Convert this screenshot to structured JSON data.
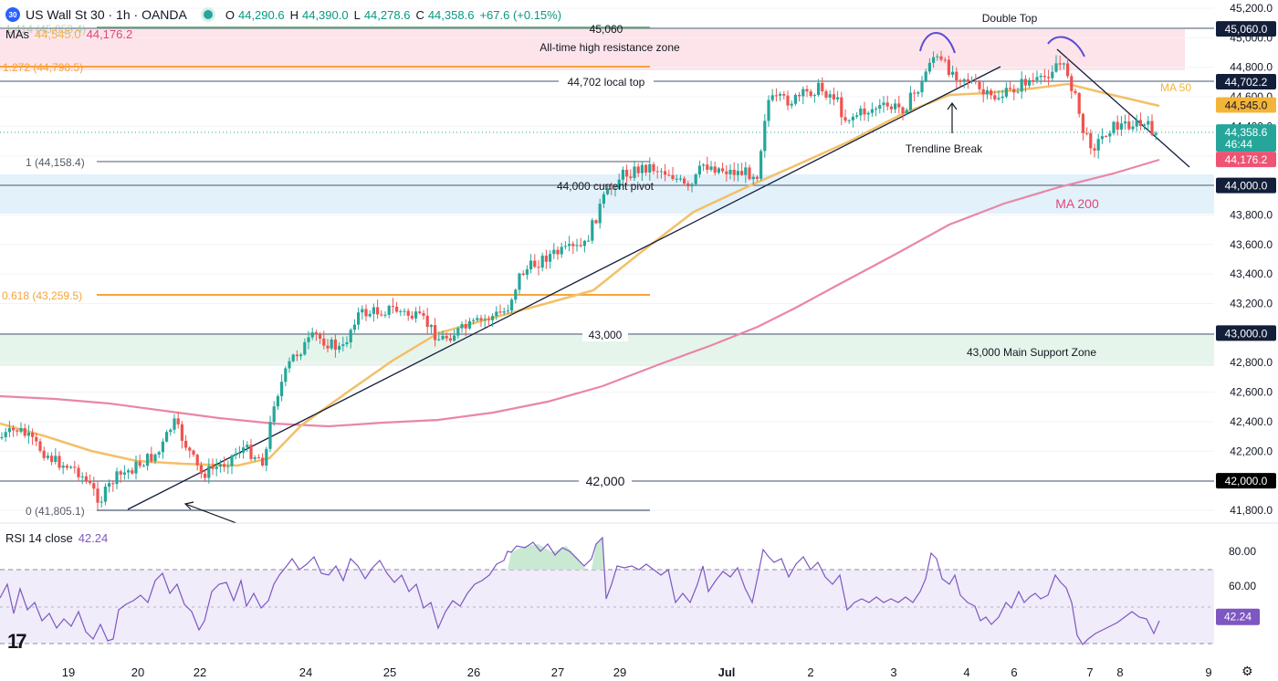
{
  "header": {
    "symbol_badge": "30",
    "title": "US Wall St 30 · 1h · OANDA",
    "ohlc": [
      {
        "k": "O",
        "v": "44,290.6"
      },
      {
        "k": "H",
        "v": "44,390.0"
      },
      {
        "k": "L",
        "v": "44,278.6"
      },
      {
        "k": "C",
        "v": "44,358.6"
      },
      {
        "k": "",
        "v": "+67.6 (+0.15%)"
      }
    ]
  },
  "mas_legend": {
    "label": "MAs",
    "ma50": "44,545.0",
    "ma200": "44,176.2"
  },
  "rsi_legend": {
    "label": "RSI 14 close",
    "value": "42.24"
  },
  "colors": {
    "bull": "#26a69a",
    "bear": "#ef5350",
    "ma50": "#f3c068",
    "ma200": "#e986a8",
    "rsi": "#7e57c2",
    "fib": "#f7a33a",
    "level": "#6b7787",
    "navy": "#131e3a"
  },
  "chart_data": [
    {
      "type": "line",
      "title": "US Wall St 30 · 1h · OANDA",
      "ylim": [
        41700,
        45300
      ],
      "y_ticks": [
        41800,
        42000,
        42200,
        42400,
        42600,
        42800,
        43000,
        43200,
        43400,
        43600,
        43800,
        44000,
        44200,
        44400,
        44600,
        44800,
        45000,
        45200
      ],
      "y_tick_labels": [
        "41,800.0",
        "42,000.0",
        "42,200.0",
        "42,400.0",
        "42,600.0",
        "42,800.0",
        "43,000.0",
        "43,200.0",
        "43,400.0",
        "43,600.0",
        "43,800.0",
        "44,000.0",
        "44,200.0",
        "44,400.0",
        "44,600.0",
        "44,800.0",
        "45,000.0",
        "45,200.0"
      ],
      "x_tick_labels": [
        "19",
        "20",
        "22",
        "24",
        "25",
        "26",
        "27",
        "29",
        "Jul",
        "2",
        "3",
        "4",
        "6",
        "7",
        "8",
        "9"
      ],
      "x_tick_pos": [
        0.5,
        1.5,
        2.5,
        3.5,
        4.5,
        5.5,
        6.5,
        7.5,
        8.5,
        9.5,
        10.5,
        11.5,
        12.5,
        13.5,
        14.5,
        15.5
      ],
      "series": [
        {
          "name": "MA 50",
          "x": [
            0,
            1,
            2,
            3,
            4,
            5,
            6,
            7,
            8,
            9,
            10,
            11,
            12,
            13,
            14
          ],
          "values": [
            42300,
            42190,
            42150,
            42450,
            42950,
            43080,
            43250,
            43800,
            44050,
            44200,
            44400,
            44600,
            44650,
            44700,
            44540
          ]
        },
        {
          "name": "MA 200",
          "x": [
            0,
            1,
            2,
            3,
            4,
            5,
            6,
            7,
            8,
            9,
            10,
            11,
            12,
            13,
            14
          ],
          "values": [
            42590,
            42500,
            42400,
            42400,
            42420,
            42500,
            42580,
            42650,
            42750,
            42900,
            43200,
            43500,
            43750,
            43950,
            44160
          ]
        },
        {
          "name": "Price",
          "x": [
            0,
            1,
            2,
            3,
            4,
            5,
            6,
            7,
            8,
            9,
            10,
            11,
            12,
            13,
            14
          ],
          "values": [
            42300,
            42050,
            42250,
            42700,
            43150,
            43100,
            43900,
            44100,
            44500,
            44600,
            44880,
            44620,
            44720,
            44380,
            44360
          ]
        }
      ],
      "labels": {
        "ath_zone": "All-time high resistance zone",
        "level_45060": "45,060",
        "double_top": "Double Top",
        "local_top": "44,702 local top",
        "trendline_break": "Trendline Break",
        "pivot": "44,000 current pivot",
        "level_43000": "43,000",
        "support_zone": "43,000 Main Support Zone",
        "level_42000": "42,000",
        "ma50": "MA 50",
        "ma200": "MA 200",
        "fib_1272": "1.272 (44,798.5)",
        "fib_1": "1 (44,158.4)",
        "fib_0618": "0.618 (43,259.5)",
        "fib_0": "0 (41,805.1)",
        "fib_1414": "1.414 (45,053.4)"
      },
      "price_tags": [
        {
          "value": 45060,
          "text": "45,060.0",
          "bg": "#131e3a"
        },
        {
          "value": 44702.2,
          "text": "44,702.2",
          "bg": "#131e3a"
        },
        {
          "value": 44545,
          "text": "44,545.0",
          "bg": "#f3b43a"
        },
        {
          "value": 44358.6,
          "text": "44,358.6",
          "sub": "46:44",
          "bg": "#26a69a"
        },
        {
          "value": 44176.2,
          "text": "44,176.2",
          "bg": "#ef5373"
        },
        {
          "value": 44000,
          "text": "44,000.0",
          "bg": "#131e3a"
        },
        {
          "value": 43000,
          "text": "43,000.0",
          "bg": "#131e3a"
        },
        {
          "value": 42000,
          "text": "42,000.0",
          "bg": "#000000"
        }
      ]
    },
    {
      "type": "line",
      "title": "RSI 14 close",
      "ylim": [
        28,
        90
      ],
      "y_ticks": [
        40,
        60,
        80
      ],
      "y_tick_labels": [
        "40.00",
        "60.00",
        "80.00"
      ],
      "bands": [
        30,
        50,
        70
      ],
      "last": 42.24,
      "series": [
        {
          "name": "RSI 14 close",
          "x": [
            0,
            1,
            2,
            3,
            4,
            5,
            6,
            7,
            8,
            9,
            10,
            11,
            12,
            13,
            14
          ],
          "values": [
            50,
            44,
            48,
            66,
            74,
            40,
            84,
            68,
            78,
            60,
            62,
            78,
            58,
            67,
            42
          ]
        }
      ]
    }
  ]
}
